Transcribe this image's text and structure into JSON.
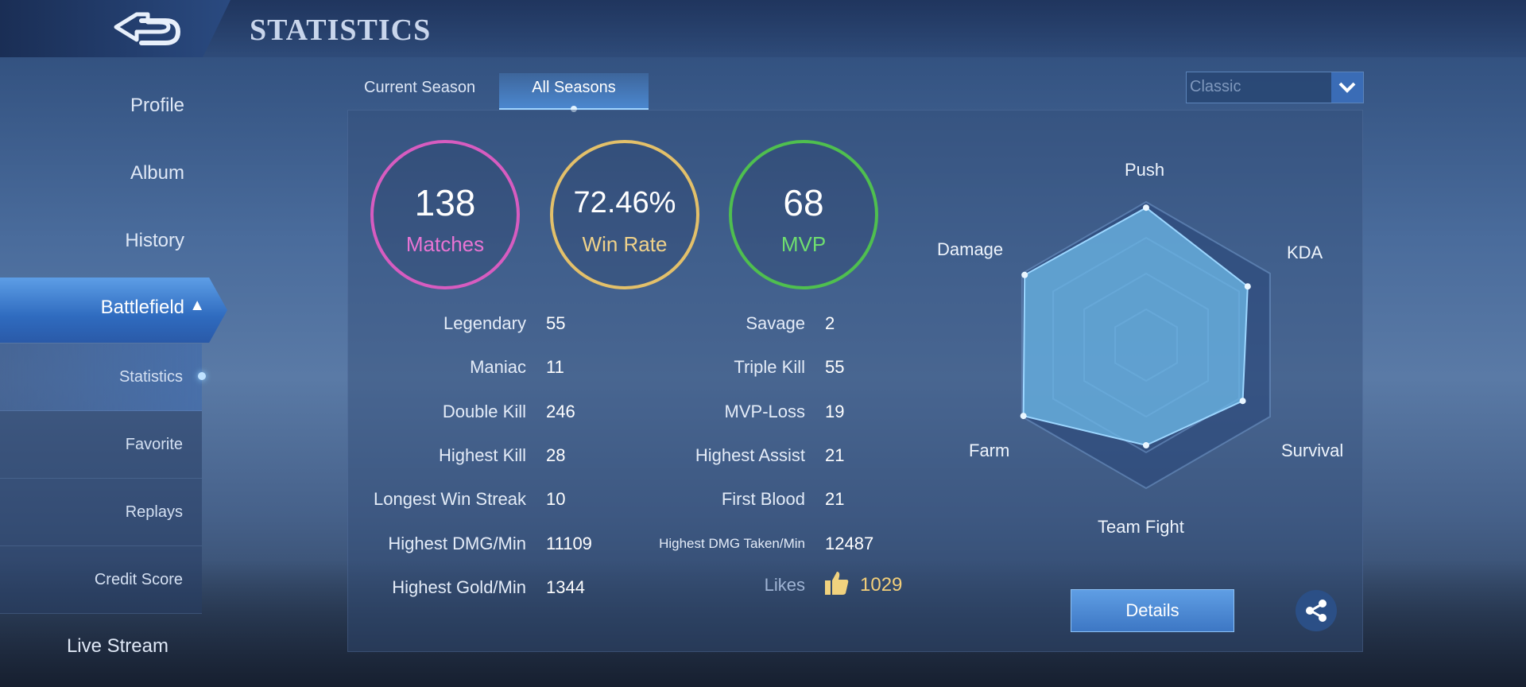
{
  "header": {
    "title": "STATISTICS",
    "back_icon": "back-arrow-icon"
  },
  "sidebar": {
    "items": [
      {
        "label": "Profile"
      },
      {
        "label": "Album"
      },
      {
        "label": "History"
      }
    ],
    "active": {
      "label": "Battlefield",
      "expand_icon": "chevron-up-icon"
    },
    "sub_items": [
      {
        "label": "Statistics"
      },
      {
        "label": "Favorite"
      },
      {
        "label": "Replays"
      },
      {
        "label": "Credit Score"
      }
    ],
    "bottom": {
      "label": "Live Stream"
    }
  },
  "tabs": [
    {
      "label": "Current Season",
      "active": false
    },
    {
      "label": "All Seasons",
      "active": true
    }
  ],
  "mode_select": {
    "value": "Classic"
  },
  "summary": {
    "matches": {
      "value": "138",
      "label": "Matches",
      "color": "#d75cc0"
    },
    "win_rate": {
      "value": "72.46%",
      "label": "Win Rate",
      "color": "#e3c06a"
    },
    "mvp": {
      "value": "68",
      "label": "MVP",
      "color": "#4fbf4f"
    }
  },
  "stats_left": [
    {
      "label": "Legendary",
      "value": "55"
    },
    {
      "label": "Maniac",
      "value": "11"
    },
    {
      "label": "Double Kill",
      "value": "246"
    },
    {
      "label": "Highest Kill",
      "value": "28"
    },
    {
      "label": "Longest Win Streak",
      "value": "10"
    },
    {
      "label": "Highest DMG/Min",
      "value": "11109"
    },
    {
      "label": "Highest Gold/Min",
      "value": "1344"
    }
  ],
  "stats_right": [
    {
      "label": "Savage",
      "value": "2"
    },
    {
      "label": "Triple Kill",
      "value": "55"
    },
    {
      "label": "MVP-Loss",
      "value": "19"
    },
    {
      "label": "Highest Assist",
      "value": "21"
    },
    {
      "label": "First Blood",
      "value": "21"
    },
    {
      "label": "Highest DMG Taken/Min",
      "value": "12487"
    }
  ],
  "likes": {
    "label": "Likes",
    "value": "1029",
    "icon": "thumbs-up-icon"
  },
  "radar": {
    "axes": [
      "Push",
      "KDA",
      "Survival",
      "Team Fight",
      "Farm",
      "Damage"
    ],
    "values": [
      0.96,
      0.82,
      0.78,
      0.7,
      0.99,
      0.98
    ],
    "fill_color": "#6bb6e6"
  },
  "details_button": {
    "label": "Details"
  },
  "share_button": {
    "icon": "share-icon"
  }
}
